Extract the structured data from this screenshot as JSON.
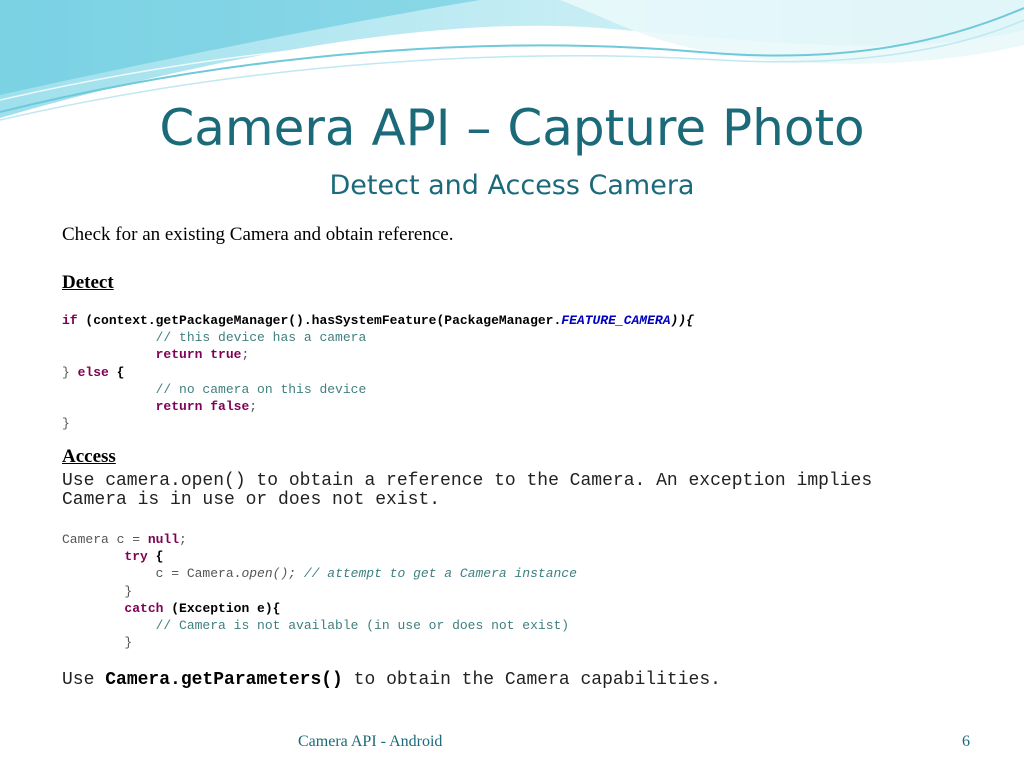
{
  "slide": {
    "title": "Camera API – Capture Photo",
    "subtitle": "Detect and Access Camera",
    "intro": "Check for an existing Camera and obtain reference.",
    "detect_heading": "Detect",
    "access_heading": "Access",
    "access_text_line1": "Use camera.open() to obtain a reference to the Camera. An exception implies",
    "access_text_line2": "Camera is in use or does not exist.",
    "params_prefix": "Use ",
    "params_method": "Camera.getParameters()",
    "params_suffix": " to obtain the Camera capabilities."
  },
  "code_detect": {
    "l1_kw": "if",
    "l1_call": " (context.getPackageManager().hasSystemFeature(PackageManager.",
    "l1_const": "FEATURE_CAMERA",
    "l1_end": ")){",
    "l2_comment": "// this device has a camera",
    "l3_kw": "return true",
    "l4_close": "} ",
    "l4_kw": "else",
    "l4_brace": " {",
    "l5_comment": "// no camera on this device",
    "l6_kw": "return false",
    "semicolon": ";",
    "l7_close": "}"
  },
  "code_access": {
    "l1_pre": "Camera c = ",
    "l1_kw": "null",
    "semicolon": ";",
    "l2_kw": "try",
    "l2_brace": " {",
    "l3_pre": "c = Camera.",
    "l3_it": "open();",
    "l3_comment": " // attempt to get a Camera instance",
    "close": "}",
    "l5_kw": "catch",
    "l5_rest": " (Exception e){",
    "l6_comment": "// Camera is not available (in use or does not exist)"
  },
  "footer": {
    "label": "Camera API - Android",
    "page": "6"
  },
  "colors": {
    "title": "#1b6a7a",
    "keyword": "#7f0055",
    "comment": "#3f7f7f",
    "constant": "#0000c0"
  }
}
